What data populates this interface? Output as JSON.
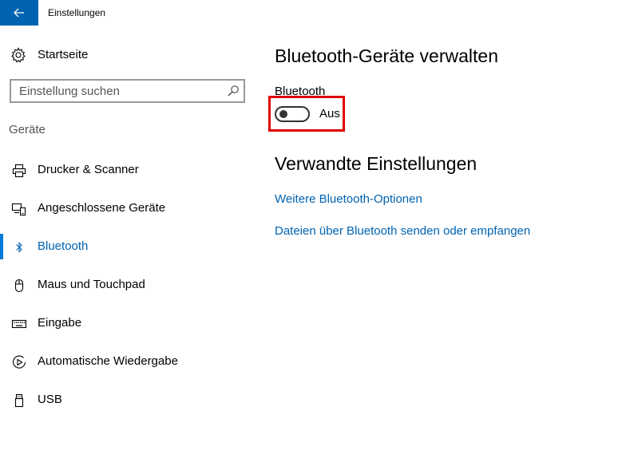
{
  "window": {
    "title": "Einstellungen",
    "accent_color": "#0063b1"
  },
  "sidebar": {
    "home": {
      "label": "Startseite",
      "icon": "gear-icon"
    },
    "search": {
      "placeholder": "Einstellung suchen",
      "value": ""
    },
    "group_label": "Geräte",
    "items": [
      {
        "label": "Drucker & Scanner",
        "icon": "printer-icon",
        "selected": false
      },
      {
        "label": "Angeschlossene Geräte",
        "icon": "connected-devices-icon",
        "selected": false
      },
      {
        "label": "Bluetooth",
        "icon": "bluetooth-icon",
        "selected": true
      },
      {
        "label": "Maus und Touchpad",
        "icon": "mouse-icon",
        "selected": false
      },
      {
        "label": "Eingabe",
        "icon": "keyboard-icon",
        "selected": false
      },
      {
        "label": "Automatische Wiedergabe",
        "icon": "autoplay-icon",
        "selected": false
      },
      {
        "label": "USB",
        "icon": "usb-icon",
        "selected": false
      }
    ]
  },
  "main": {
    "title": "Bluetooth-Geräte verwalten",
    "bluetooth_toggle": {
      "label": "Bluetooth",
      "state_text": "Aus",
      "on": false
    },
    "related": {
      "title": "Verwandte Einstellungen",
      "links": [
        "Weitere Bluetooth-Optionen",
        "Dateien über Bluetooth senden oder empfangen"
      ]
    },
    "highlight_color": "#e00000"
  }
}
